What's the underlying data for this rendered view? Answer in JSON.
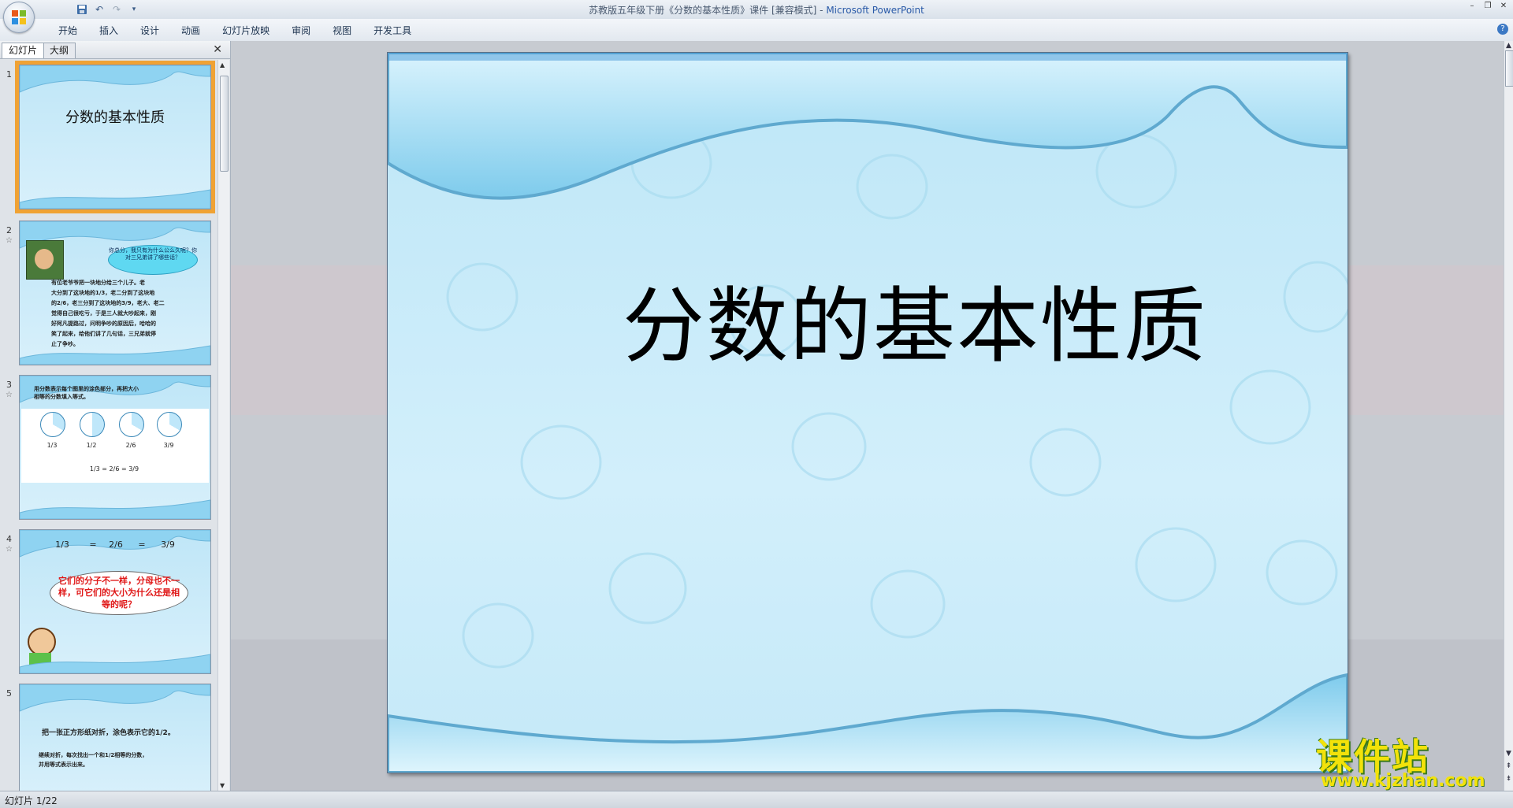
{
  "window": {
    "title": "苏教版五年级下册《分数的基本性质》课件 [兼容模式] - ",
    "app_name": "Microsoft PowerPoint"
  },
  "ribbon": {
    "tabs": [
      "开始",
      "插入",
      "设计",
      "动画",
      "幻灯片放映",
      "审阅",
      "视图",
      "开发工具"
    ]
  },
  "panel": {
    "tab_slides": "幻灯片",
    "tab_outline": "大纲"
  },
  "thumbnails": [
    {
      "num": "1",
      "title": "分数的基本性质"
    },
    {
      "num": "2",
      "bubble": "你总分，我只有为什么公么久呢？你对三兄弟讲了哪些话？",
      "body": [
        "有位老爷爷把一块地分给三个儿子。老",
        "大分到了这块地的1/3，老二分到了这块地",
        "的2/6，老三分到了这块地的3/9，老大、老二",
        "觉得自己很吃亏，于是三人就大吵起来，刚",
        "好阿凡提路过，问明争吵的原因后，哈哈的",
        "笑了起来，给他们讲了几句话，三兄弟就停",
        "止了争吵。"
      ]
    },
    {
      "num": "3",
      "heading": [
        "用分数表示每个图里的涂色部分，再把大小",
        "相等的分数填入等式。"
      ],
      "fracs": [
        "1/3",
        "1/2",
        "2/6",
        "3/9"
      ],
      "equation": "1/3 = 2/6 = 3/9"
    },
    {
      "num": "4",
      "fracs": [
        "1/3",
        "2/6",
        "3/9"
      ],
      "equals": "=",
      "bubble": "它们的分子不一样，分母也不一样，可它们的大小为什么还是相等的呢？"
    },
    {
      "num": "5",
      "line1": "把一张正方形纸对折，涂色表示它的1/2。",
      "line2": "继续对折，每次找出一个和1/2相等的分数，",
      "line3": "并用等式表示出来。"
    }
  ],
  "slide": {
    "title": "分数的基本性质"
  },
  "watermark": {
    "text": "课件站",
    "url": "www.kjzhan.com"
  },
  "status": {
    "text": "幻灯片 1/22"
  },
  "icons": [
    "office-logo-icon",
    "save-icon",
    "undo-icon",
    "redo-icon",
    "customize-icon",
    "minimize-icon",
    "restore-icon",
    "close-icon",
    "help-icon",
    "star-icon"
  ]
}
